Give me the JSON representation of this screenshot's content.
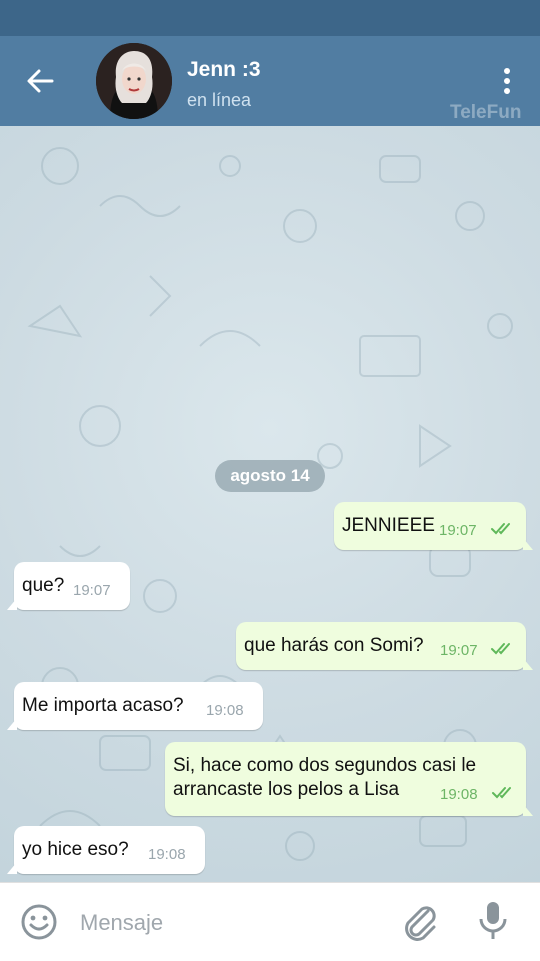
{
  "header": {
    "contact_name": "Jenn :3",
    "status": "en línea",
    "watermark": "TeleFun"
  },
  "chat": {
    "date_label": "agosto 14",
    "messages": [
      {
        "direction": "out",
        "text": "JENNIEEE",
        "time": "19:07",
        "read": true
      },
      {
        "direction": "in",
        "text": "que?",
        "time": "19:07"
      },
      {
        "direction": "out",
        "text": "que harás con Somi?",
        "time": "19:07",
        "read": true
      },
      {
        "direction": "in",
        "text": "Me importa acaso?",
        "time": "19:08"
      },
      {
        "direction": "out",
        "text_line1": "Si, hace como dos segundos casi le",
        "text_line2": "arrancaste los pelos a Lisa",
        "time": "19:08",
        "read": true
      },
      {
        "direction": "in",
        "text": "yo hice eso?",
        "time": "19:08"
      }
    ]
  },
  "input": {
    "placeholder": "Mensaje"
  },
  "icons": [
    "back-arrow-icon",
    "more-vert-icon",
    "emoji-icon",
    "attach-icon",
    "mic-icon",
    "double-check-icon"
  ],
  "colors": {
    "header": "#517da2",
    "statusbar": "#3d6689",
    "outgoing_bubble": "#effdde",
    "incoming_bubble": "#ffffff",
    "read_check": "#5fb85a"
  }
}
